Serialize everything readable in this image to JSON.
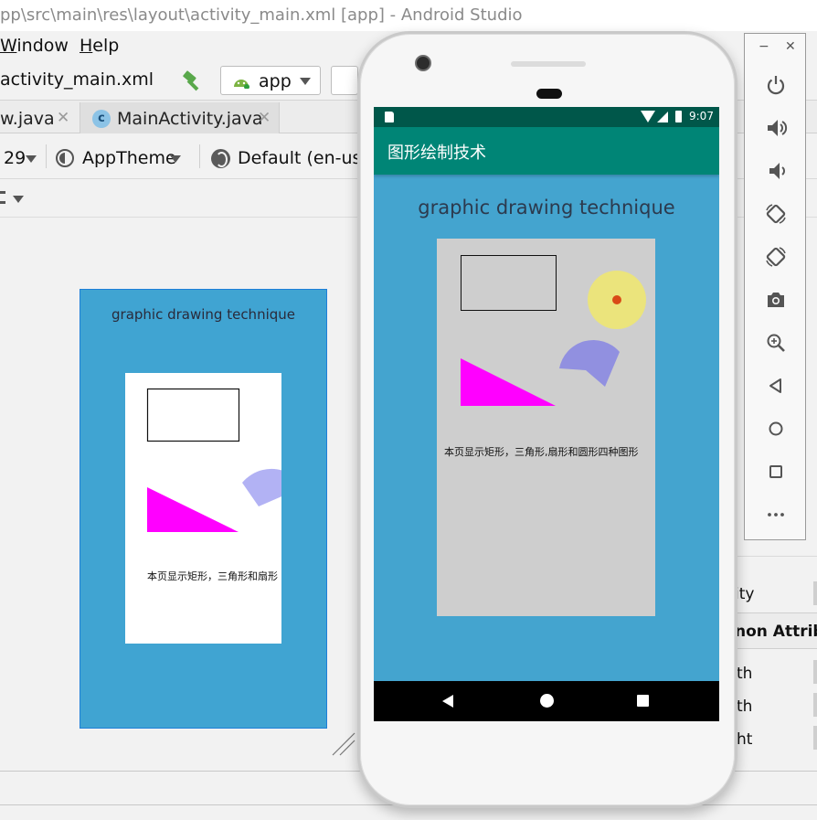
{
  "window": {
    "title": "pp\\src\\main\\res\\layout\\activity_main.xml [app] - Android Studio"
  },
  "menu": {
    "window_label": "Window",
    "help_label": "Help"
  },
  "toolbar": {
    "file_label": "activity_main.xml",
    "run_config": "app"
  },
  "tabs": [
    {
      "label": "w.java"
    },
    {
      "label": "MainActivity.java",
      "icon_letter": "c"
    }
  ],
  "design_toolbar": {
    "api_level": "29",
    "theme": "AppTheme",
    "locale": "Default (en-us)"
  },
  "preview": {
    "title": "graphic drawing technique",
    "caption": "本页显示矩形，三角形和扇形",
    "background": "#40a4d2"
  },
  "attributes_panel": {
    "frag_ity": "ity",
    "common_header": "non Attrib",
    "frag_th1": "th",
    "frag_th2": "th",
    "frag_ht": "ht"
  },
  "emulator": {
    "status_time": "9:07",
    "app_title": "图形绘制技术",
    "heading": "graphic drawing technique",
    "caption": "本页显示矩形，三角形,扇形和圆形四种图形",
    "colors": {
      "status_bar": "#00574a",
      "app_bar": "#008576",
      "background": "#44a4cf",
      "card": "#cecece",
      "triangle": "#ff00ff",
      "sector": "#9190e0",
      "circle": "#ebe47c",
      "center_dot": "#d94a16"
    }
  },
  "side_panel": {
    "icons": [
      "power-icon",
      "volume-up-icon",
      "volume-down-icon",
      "rotate-left-icon",
      "rotate-right-icon",
      "camera-icon",
      "zoom-icon",
      "back-icon",
      "home-icon",
      "overview-icon",
      "more-icon"
    ]
  }
}
